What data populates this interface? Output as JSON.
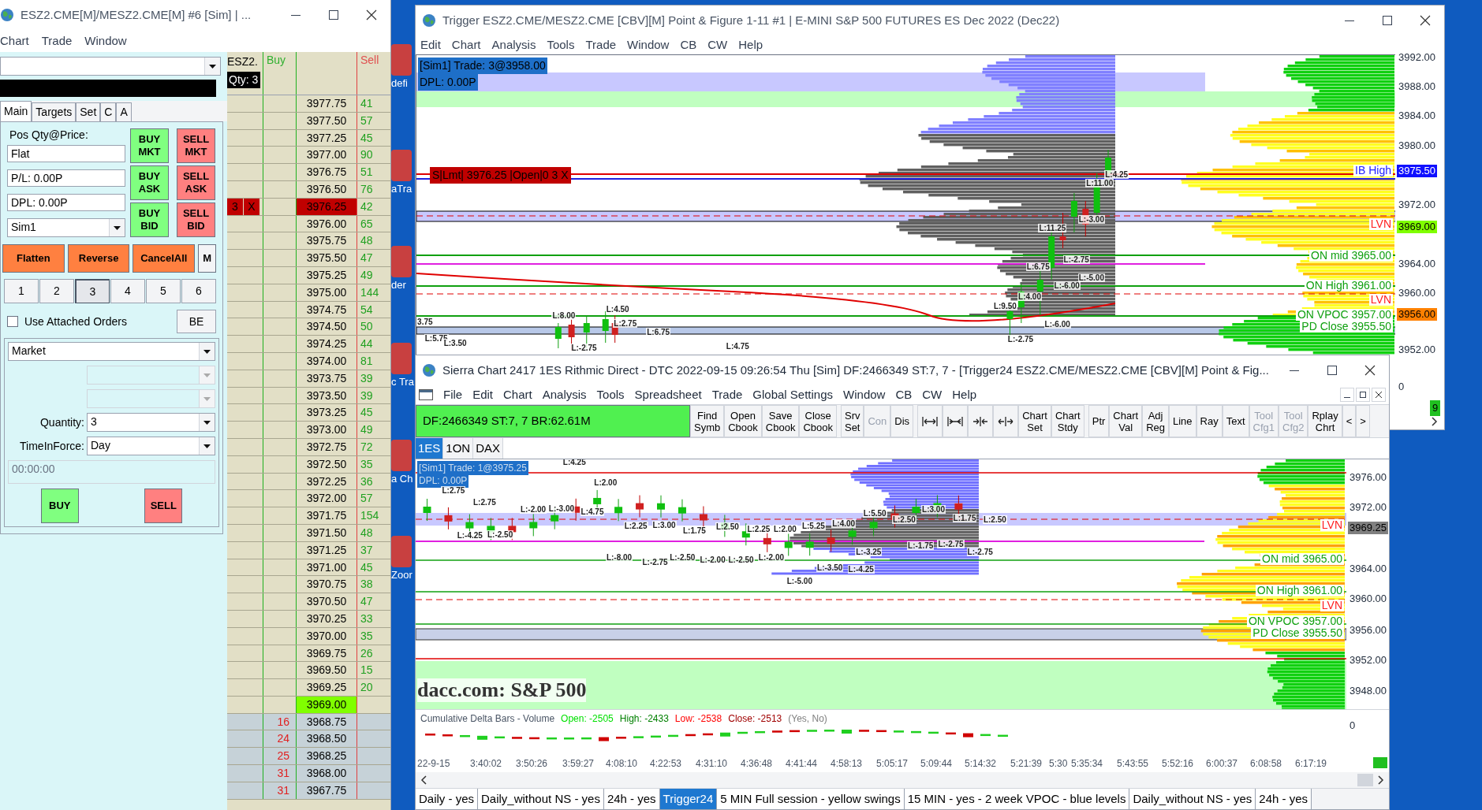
{
  "desktop": {
    "icon_labels": [
      "defi",
      "aTra",
      "der",
      "c Tra",
      "a Ch",
      "Zoor"
    ]
  },
  "dom_window": {
    "title": "ESZ2.CME[M]/MESZ2.CME[M]  #6 [Sim]  | ...",
    "menu": [
      "Chart",
      "Trade",
      "Window"
    ],
    "tabs": [
      {
        "label": "Main",
        "selected": true
      },
      {
        "label": "Targets",
        "selected": false
      },
      {
        "label": "Set",
        "selected": false
      },
      {
        "label": "C",
        "selected": false
      },
      {
        "label": "A",
        "selected": false
      }
    ],
    "pos_label": "Pos Qty@Price:",
    "position": "Flat",
    "pl": "P/L: 0.00P",
    "dpl": "DPL: 0.00P",
    "account": "Sim1",
    "order_buttons": [
      {
        "lines": [
          "BUY",
          "MKT"
        ],
        "kind": "buy"
      },
      {
        "lines": [
          "SELL",
          "MKT"
        ],
        "kind": "sell"
      },
      {
        "lines": [
          "BUY",
          "ASK"
        ],
        "kind": "buy"
      },
      {
        "lines": [
          "SELL",
          "ASK"
        ],
        "kind": "sell"
      },
      {
        "lines": [
          "BUY",
          "BID"
        ],
        "kind": "buy"
      },
      {
        "lines": [
          "SELL",
          "BID"
        ],
        "kind": "sell"
      }
    ],
    "action_buttons": [
      {
        "label": "Flatten",
        "kind": "orange"
      },
      {
        "label": "Reverse",
        "kind": "orange"
      },
      {
        "label": "CancelAll",
        "kind": "orange"
      },
      {
        "label": "M",
        "kind": "plain"
      }
    ],
    "qty_buttons": [
      {
        "label": "1",
        "selected": false
      },
      {
        "label": "2",
        "selected": false
      },
      {
        "label": "3",
        "selected": true
      },
      {
        "label": "4",
        "selected": false
      },
      {
        "label": "5",
        "selected": false
      },
      {
        "label": "6",
        "selected": false
      }
    ],
    "attached_orders": {
      "label": "Use Attached Orders",
      "checked": false
    },
    "be_button": "BE",
    "order_type": "Market",
    "quantity_label": "Quantity:",
    "quantity": "3",
    "tif_label": "TimeInForce:",
    "tif": "Day",
    "time": "00:00:00",
    "buy": "BUY",
    "sell": "SELL",
    "ladder": {
      "symbol": "ESZ2.",
      "qty": "Qty: 3",
      "buy_header": "Buy",
      "sell_header": "Sell",
      "order_cells": [
        "3",
        "X"
      ],
      "rows": [
        {
          "price": "3977.75",
          "sell": "41",
          "kind": "ask"
        },
        {
          "price": "3977.50",
          "sell": "57",
          "kind": "ask"
        },
        {
          "price": "3977.25",
          "sell": "45",
          "kind": "ask"
        },
        {
          "price": "3977.00",
          "sell": "90",
          "kind": "ask"
        },
        {
          "price": "3976.75",
          "sell": "51",
          "kind": "ask"
        },
        {
          "price": "3976.50",
          "sell": "76",
          "kind": "ask"
        },
        {
          "price": "3976.25",
          "sell": "42",
          "kind": "order"
        },
        {
          "price": "3976.00",
          "sell": "65",
          "kind": "ask"
        },
        {
          "price": "3975.75",
          "sell": "48",
          "kind": "ask"
        },
        {
          "price": "3975.50",
          "sell": "47",
          "kind": "ask"
        },
        {
          "price": "3975.25",
          "sell": "49",
          "kind": "ask"
        },
        {
          "price": "3975.00",
          "sell": "144",
          "kind": "ask"
        },
        {
          "price": "3974.75",
          "sell": "54",
          "kind": "ask"
        },
        {
          "price": "3974.50",
          "sell": "50",
          "kind": "ask"
        },
        {
          "price": "3974.25",
          "sell": "44",
          "kind": "ask"
        },
        {
          "price": "3974.00",
          "sell": "81",
          "kind": "ask"
        },
        {
          "price": "3973.75",
          "sell": "39",
          "kind": "ask"
        },
        {
          "price": "3973.50",
          "sell": "39",
          "kind": "ask"
        },
        {
          "price": "3973.25",
          "sell": "45",
          "kind": "ask"
        },
        {
          "price": "3973.00",
          "sell": "49",
          "kind": "ask"
        },
        {
          "price": "3972.75",
          "sell": "72",
          "kind": "ask"
        },
        {
          "price": "3972.50",
          "sell": "35",
          "kind": "ask"
        },
        {
          "price": "3972.25",
          "sell": "36",
          "kind": "ask"
        },
        {
          "price": "3972.00",
          "sell": "57",
          "kind": "ask"
        },
        {
          "price": "3971.75",
          "sell": "154",
          "kind": "ask"
        },
        {
          "price": "3971.50",
          "sell": "48",
          "kind": "ask"
        },
        {
          "price": "3971.25",
          "sell": "37",
          "kind": "ask"
        },
        {
          "price": "3971.00",
          "sell": "45",
          "kind": "ask"
        },
        {
          "price": "3970.75",
          "sell": "38",
          "kind": "ask"
        },
        {
          "price": "3970.50",
          "sell": "47",
          "kind": "ask"
        },
        {
          "price": "3970.25",
          "sell": "33",
          "kind": "ask"
        },
        {
          "price": "3970.00",
          "sell": "35",
          "kind": "ask"
        },
        {
          "price": "3969.75",
          "sell": "26",
          "kind": "ask"
        },
        {
          "price": "3969.50",
          "sell": "15",
          "kind": "ask"
        },
        {
          "price": "3969.25",
          "sell": "20",
          "kind": "ask"
        },
        {
          "price": "3969.00",
          "kind": "last"
        },
        {
          "price": "3968.75",
          "buy": "16",
          "kind": "bid"
        },
        {
          "price": "3968.50",
          "buy": "24",
          "kind": "bid"
        },
        {
          "price": "3968.25",
          "buy": "25",
          "kind": "bid"
        },
        {
          "price": "3968.00",
          "buy": "31",
          "kind": "bid"
        },
        {
          "price": "3967.75",
          "buy": "31",
          "kind": "bid"
        }
      ]
    }
  },
  "pf_window": {
    "title": "Trigger ESZ2.CME/MESZ2.CME [CBV][M]  Point & Figure 1-11  #1 | E-MINI S&P 500 FUTURES ES Dec 2022 (Dec22)",
    "menu": [
      "Edit",
      "Chart",
      "Analysis",
      "Tools",
      "Trade",
      "Window",
      "CB",
      "CW",
      "Help"
    ],
    "trade_label": "[Sim1]  Trade: 3@3958.00",
    "dpl_label": "DPL: 0.00P",
    "order_label": "S|Lmt| 3976.25 |Open|0  3  X",
    "levels": [
      {
        "text": "IB High",
        "color": "#2020ff"
      },
      {
        "text": "LVN",
        "color": "#ff2020"
      },
      {
        "text": "ON mid  3965.00",
        "color": "#10a010"
      },
      {
        "text": "ON High  3961.00",
        "color": "#10a010"
      },
      {
        "text": "LVN",
        "color": "#ff2020"
      },
      {
        "text": "ON VPOC  3957.00",
        "color": "#10a010"
      },
      {
        "text": "PD Close  3955.50",
        "color": "#10a010"
      }
    ],
    "bar_labels": [
      "L:4.25",
      "L:11.00",
      "L:-3.00",
      "L:11.25",
      "L:-2.75",
      "L:-5.00",
      "L:6.75",
      "L:-6.00",
      "L:9.50",
      "L:4.00",
      "L:-6.00",
      "L:-2.75",
      "L:8.00",
      "L:4.50",
      "L:2.75",
      "L:-2.75",
      "L:6.75",
      "L:4.75",
      "L:5.75",
      "L:3.50",
      "3.75"
    ],
    "axis": [
      {
        "text": "3992.00",
        "kind": "plain"
      },
      {
        "text": "3988.00",
        "kind": "plain"
      },
      {
        "text": "3984.00",
        "kind": "plain"
      },
      {
        "text": "3980.00",
        "kind": "plain"
      },
      {
        "text": "3975.50",
        "kind": "marker",
        "color": "#1010ff"
      },
      {
        "text": "3972.00",
        "kind": "plain"
      },
      {
        "text": "3969.00",
        "kind": "marker",
        "color": "#80ff00"
      },
      {
        "text": "3964.00",
        "kind": "plain"
      },
      {
        "text": "3960.00",
        "kind": "plain"
      },
      {
        "text": "3956.00",
        "kind": "marker",
        "color": "#ff8000"
      },
      {
        "text": "3952.00",
        "kind": "plain"
      },
      {
        "text": "0",
        "kind": "plain"
      }
    ],
    "corner_badge": "9"
  },
  "sc_window": {
    "title": "Sierra Chart 2417 1ES  Rithmic Direct - DTC 2022-09-15  09:26:54 Thu [Sim]  DF:2466349  ST:7, 7 - [Trigger24 ESZ2.CME/MESZ2.CME [CBV][M]  Point & Fig...",
    "menu": [
      "File",
      "Edit",
      "Chart",
      "Analysis",
      "Tools",
      "Spreadsheet",
      "Trade",
      "Global Settings",
      "Window",
      "CB",
      "CW",
      "Help"
    ],
    "status": "DF:2466349  ST:7, 7  BR:62.61M",
    "toolbar": [
      {
        "lines": [
          "Find",
          "Symb"
        ],
        "kind": "text",
        "disabled": false
      },
      {
        "lines": [
          "Open",
          "Cbook"
        ],
        "kind": "text",
        "disabled": false
      },
      {
        "lines": [
          "Save",
          "Cbook"
        ],
        "kind": "text",
        "disabled": false
      },
      {
        "lines": [
          "Close",
          "Cbook"
        ],
        "kind": "text",
        "disabled": false
      },
      {
        "lines": [
          "Srv",
          "Set"
        ],
        "kind": "text",
        "disabled": false
      },
      {
        "lines": [
          "Con"
        ],
        "kind": "text",
        "disabled": true
      },
      {
        "lines": [
          "Dis"
        ],
        "kind": "text",
        "disabled": false
      },
      {
        "kind": "zoom-out"
      },
      {
        "kind": "zoom-in"
      },
      {
        "kind": "narrow"
      },
      {
        "kind": "widen"
      },
      {
        "lines": [
          "Chart",
          "Set"
        ],
        "kind": "text",
        "disabled": false
      },
      {
        "lines": [
          "Chart",
          "Stdy"
        ],
        "kind": "text",
        "disabled": false
      },
      {
        "lines": [
          "Ptr"
        ],
        "kind": "text",
        "disabled": false
      },
      {
        "lines": [
          "Chart",
          "Val"
        ],
        "kind": "text",
        "disabled": false
      },
      {
        "lines": [
          "Adj",
          "Reg"
        ],
        "kind": "text",
        "disabled": false
      },
      {
        "lines": [
          "Line"
        ],
        "kind": "text",
        "disabled": false
      },
      {
        "lines": [
          "Ray"
        ],
        "kind": "text",
        "disabled": false
      },
      {
        "lines": [
          "Text"
        ],
        "kind": "text",
        "disabled": false
      },
      {
        "lines": [
          "Tool",
          "Cfg1"
        ],
        "kind": "text",
        "disabled": true
      },
      {
        "lines": [
          "Tool",
          "Cfg2"
        ],
        "kind": "text",
        "disabled": true
      },
      {
        "lines": [
          "Rplay",
          "Chrt"
        ],
        "kind": "text",
        "disabled": false
      },
      {
        "lines": [
          "<"
        ],
        "kind": "text",
        "disabled": false
      },
      {
        "lines": [
          ">"
        ],
        "kind": "text",
        "disabled": false
      }
    ],
    "chart_tabs": [
      {
        "label": "1ES",
        "selected": true
      },
      {
        "label": "1ON",
        "selected": false
      },
      {
        "label": "DAX",
        "selected": false
      }
    ],
    "trade_label": "[Sim1]  Trade: 1@3975.25",
    "dpl_label": "DPL: 0.00P",
    "watermark_title": "dacc.com: S&P 500",
    "levels": [
      {
        "text": "LVN",
        "color": "#ff2020"
      },
      {
        "text": "ON mid  3965.00",
        "color": "#10a010"
      },
      {
        "text": "ON High  3961.00",
        "color": "#10a010"
      },
      {
        "text": "LVN",
        "color": "#ff2020"
      },
      {
        "text": "ON VPOC  3957.00",
        "color": "#10a010"
      },
      {
        "text": "PD Close  3955.50",
        "color": "#10a010"
      }
    ],
    "bar_labels": [
      "L:4.25",
      "L:2.00",
      "L:2.75",
      "L:2.75",
      "L:-2.00",
      "L:-3.00",
      "L:4.75",
      "L:-4.25",
      "L:-2.50",
      "L:2.25",
      "L:3.00",
      "L:1.75",
      "L:2.50",
      "L:2.25",
      "L:2.00",
      "L:5.25",
      "L:4.00",
      "L:5.50",
      "L:2.50",
      "L:3.00",
      "L:1.75",
      "L:2.50",
      "L:-8.00",
      "L:-2.75",
      "L:-2.50",
      "L:-2.00",
      "L:-2.50",
      "L:-2.00",
      "L:-3.25",
      "L:-1.75",
      "L:-2.75",
      "L:-2.75",
      "L:-3.50",
      "L:-4.25",
      "L:-5.00"
    ],
    "axis": [
      {
        "text": "3976.00",
        "kind": "plain"
      },
      {
        "text": "3972.00",
        "kind": "plain"
      },
      {
        "text": "3969.25",
        "kind": "marker",
        "color": "#808080"
      },
      {
        "text": "3964.00",
        "kind": "plain"
      },
      {
        "text": "3960.00",
        "kind": "plain"
      },
      {
        "text": "3956.00",
        "kind": "plain"
      },
      {
        "text": "3952.00",
        "kind": "plain"
      },
      {
        "text": "3948.00",
        "kind": "plain"
      },
      {
        "text": "0",
        "kind": "plain"
      }
    ],
    "study": {
      "name": "Cumulative Delta Bars - Volume",
      "values": [
        {
          "text": "Open: -2505",
          "color": "#00e000"
        },
        {
          "text": "High: -2433",
          "color": "#008000"
        },
        {
          "text": "Low: -2538",
          "color": "#ff0000"
        },
        {
          "text": "Close: -2513",
          "color": "#a00000"
        },
        {
          "text": "(Yes, No)",
          "color": "#808080"
        }
      ]
    },
    "times": [
      "22-9-15",
      "3:40:02",
      "3:50:26",
      "3:59:27",
      "4:08:10",
      "4:22:53",
      "4:31:10",
      "4:36:48",
      "4:41:44",
      "4:58:13",
      "5:05:17",
      "5:09:44",
      "5:14:32",
      "5:21:39",
      "5:30",
      "5:35:34",
      "5:43:55",
      "5:52:16",
      "6:00:37",
      "6:08:58",
      "6:17:19"
    ],
    "bottom_tabs": [
      {
        "label": "Daily - yes",
        "selected": false
      },
      {
        "label": "Daily_without NS - yes",
        "selected": false
      },
      {
        "label": "24h - yes",
        "selected": false
      },
      {
        "label": "Trigger24",
        "selected": true
      },
      {
        "label": "5 MIN Full session - yellow swings",
        "selected": false
      },
      {
        "label": "15 MIN - yes - 2 week VPOC - blue levels",
        "selected": false
      },
      {
        "label": "Daily_without NS - yes",
        "selected": false
      },
      {
        "label": "24h - yes",
        "selected": false
      }
    ]
  }
}
